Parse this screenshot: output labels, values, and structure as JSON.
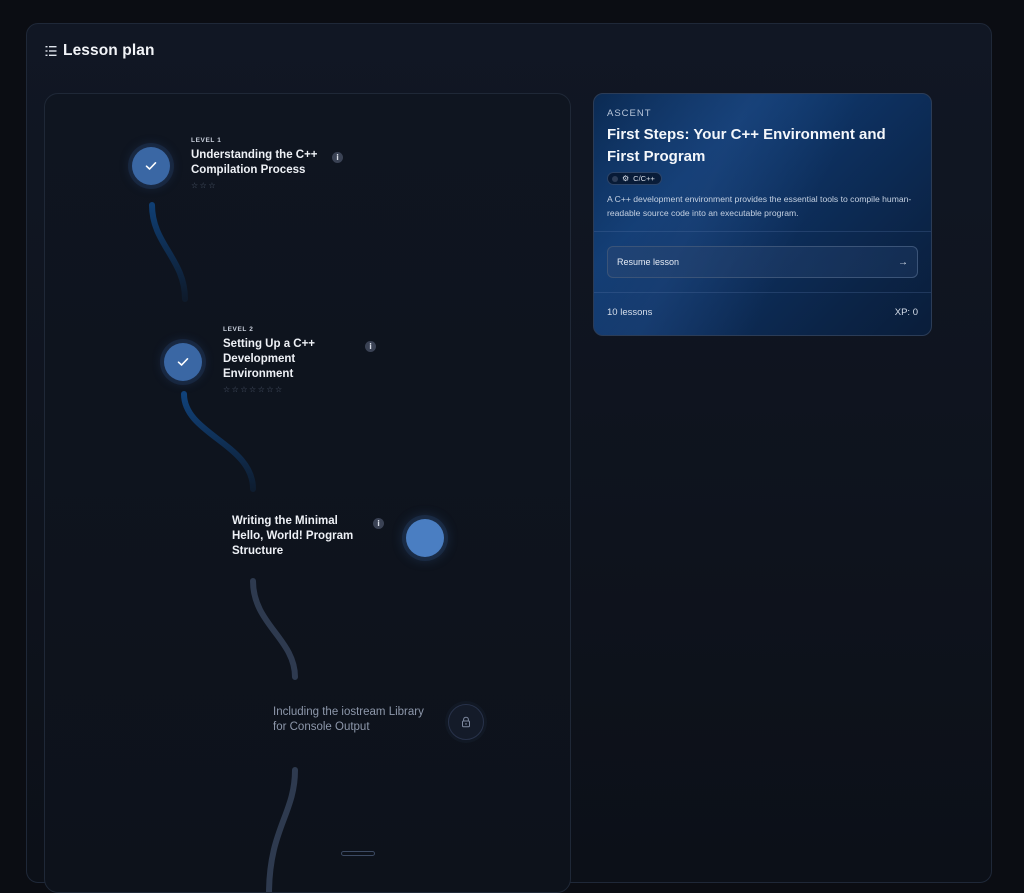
{
  "header": {
    "title": "Lesson plan",
    "icon": "list-icon"
  },
  "path": {
    "lessons": [
      {
        "level": "LEVEL 1",
        "title": "Understanding the C++ Compilation Process",
        "status": "completed",
        "stars": "☆☆☆"
      },
      {
        "level": "LEVEL 2",
        "title": "Setting Up a C++ Development Environment",
        "status": "completed",
        "stars": "☆☆☆☆☆☆☆"
      },
      {
        "title": "Writing the Minimal Hello, World! Program Structure",
        "status": "current"
      },
      {
        "title": "Including the iostream Library for Console Output",
        "status": "locked"
      }
    ],
    "colors": {
      "completed_path": "#0f3e73",
      "locked_path": "#2e3a4f",
      "node_done": "#3a67a4",
      "node_current": "#4a7ec2"
    }
  },
  "course": {
    "eyebrow": "ASCENT",
    "title": "First Steps: Your C++ Environment and First Program",
    "language": "C/C++",
    "description": "A C++ development environment provides the essential tools to compile human-readable source code into an executable program.",
    "resume_label": "Resume lesson",
    "lessons_count": "10 lessons",
    "xp": "XP: 0"
  }
}
